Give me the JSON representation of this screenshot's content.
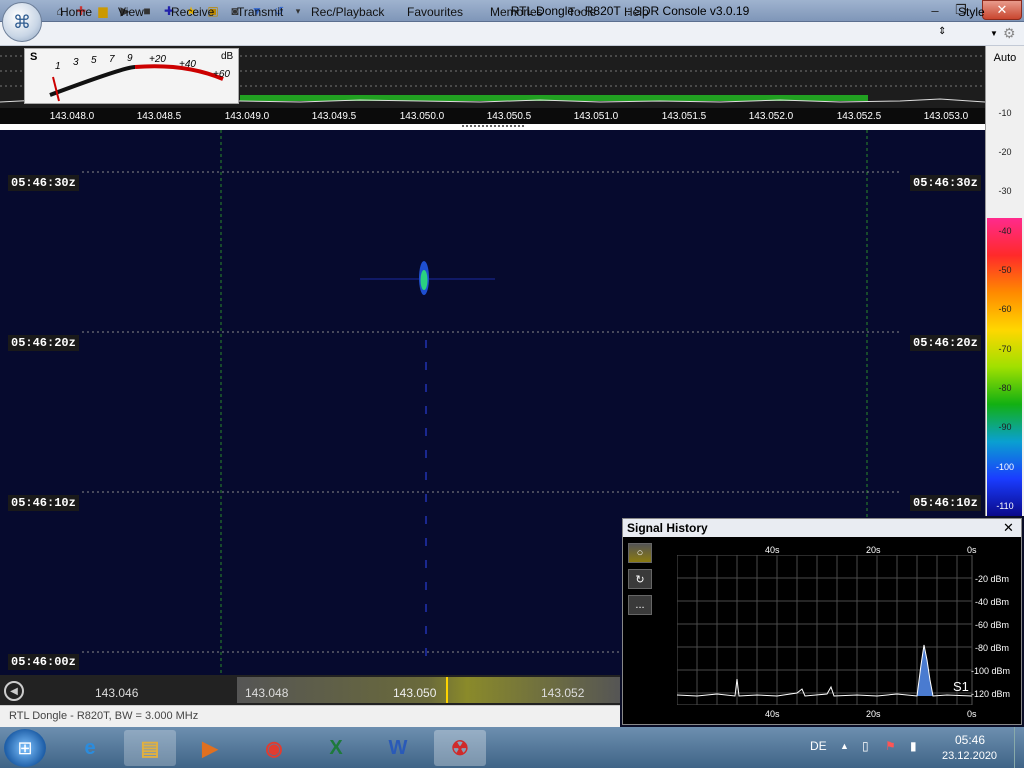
{
  "window": {
    "title": "RTL Dongle - R820T :: SDR Console v3.0.19"
  },
  "menu": {
    "items": [
      "Home",
      "View",
      "Receive",
      "Transmit",
      "Rec/Playback",
      "Favourites",
      "Memories",
      "Tools",
      "Help"
    ],
    "style_label": "Style"
  },
  "smeter": {
    "s_label": "S",
    "db_label": "dB",
    "scale": [
      "1",
      "3",
      "5",
      "7",
      "9",
      "+20",
      "+40",
      "+60"
    ]
  },
  "freq_axis": [
    "143.048.0",
    "143.048.5",
    "143.049.0",
    "143.049.5",
    "143.050.0",
    "143.050.5",
    "143.051.0",
    "143.051.5",
    "143.052.0",
    "143.052.5",
    "143.053.0"
  ],
  "db_scale": {
    "auto_label": "Auto",
    "values": [
      "-10",
      "-20",
      "-30",
      "-40",
      "-50",
      "-60",
      "-70",
      "-80",
      "-90",
      "-100",
      "-110"
    ]
  },
  "waterfall": {
    "times": [
      "05:46:30z",
      "05:46:20z",
      "05:46:10z",
      "05:46:00z"
    ]
  },
  "ruler": {
    "labels": [
      "143.046",
      "143.048",
      "143.050",
      "143.052"
    ]
  },
  "status": {
    "text": "RTL Dongle - R820T, BW = 3.000 MHz"
  },
  "signal_history": {
    "title": "Signal History",
    "top_labels": [
      "40s",
      "20s",
      "0s"
    ],
    "bottom_labels": [
      "40s",
      "20s",
      "0s"
    ],
    "dbm": [
      "-20 dBm",
      "-40 dBm",
      "-60 dBm",
      "-80 dBm",
      "-100 dBm",
      "-120 dBm"
    ],
    "s_value": "S1",
    "buttons": [
      "○",
      "↻",
      "..."
    ]
  },
  "taskbar": {
    "lang": "DE",
    "time": "05:46",
    "date": "23.12.2020"
  }
}
